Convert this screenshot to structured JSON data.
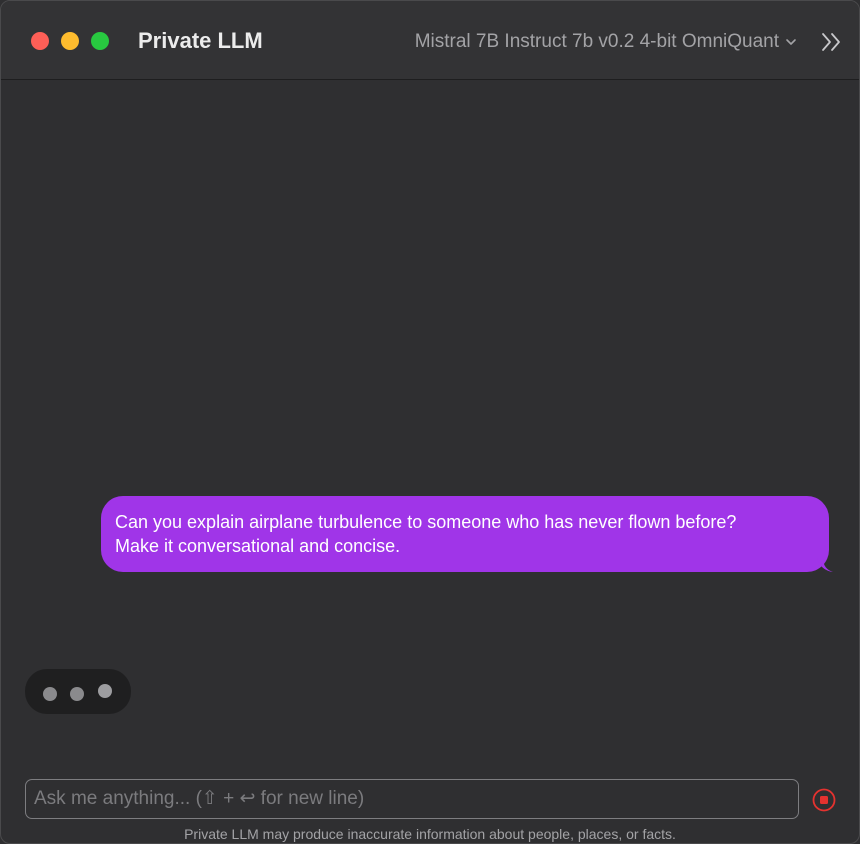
{
  "app": {
    "title": "Private LLM"
  },
  "header": {
    "model_name": "Mistral 7B Instruct 7b v0.2 4-bit OmniQuant",
    "model_dropdown_icon": "chevron-down-icon",
    "sidebar_toggle_icon": "double-chevron-right-icon"
  },
  "window_controls": {
    "close_color": "#fe5f57",
    "minimize_color": "#febc2e",
    "maximize_color": "#28c840"
  },
  "messages": [
    {
      "role": "user",
      "lines": [
        "Can you explain airplane turbulence to someone who has never flown before?",
        "Make it conversational and concise."
      ]
    }
  ],
  "typing_indicator": {
    "dots": 3
  },
  "composer": {
    "placeholder": "Ask me anything... (⇧ + ↩ for new line)",
    "value": "",
    "stop_icon": "stop-icon"
  },
  "footer": {
    "disclaimer": "Private LLM may produce inaccurate information about people, places, or facts."
  },
  "colors": {
    "accent": "#a035e8",
    "stop": "#e5322f",
    "background": "#2f2f31"
  }
}
